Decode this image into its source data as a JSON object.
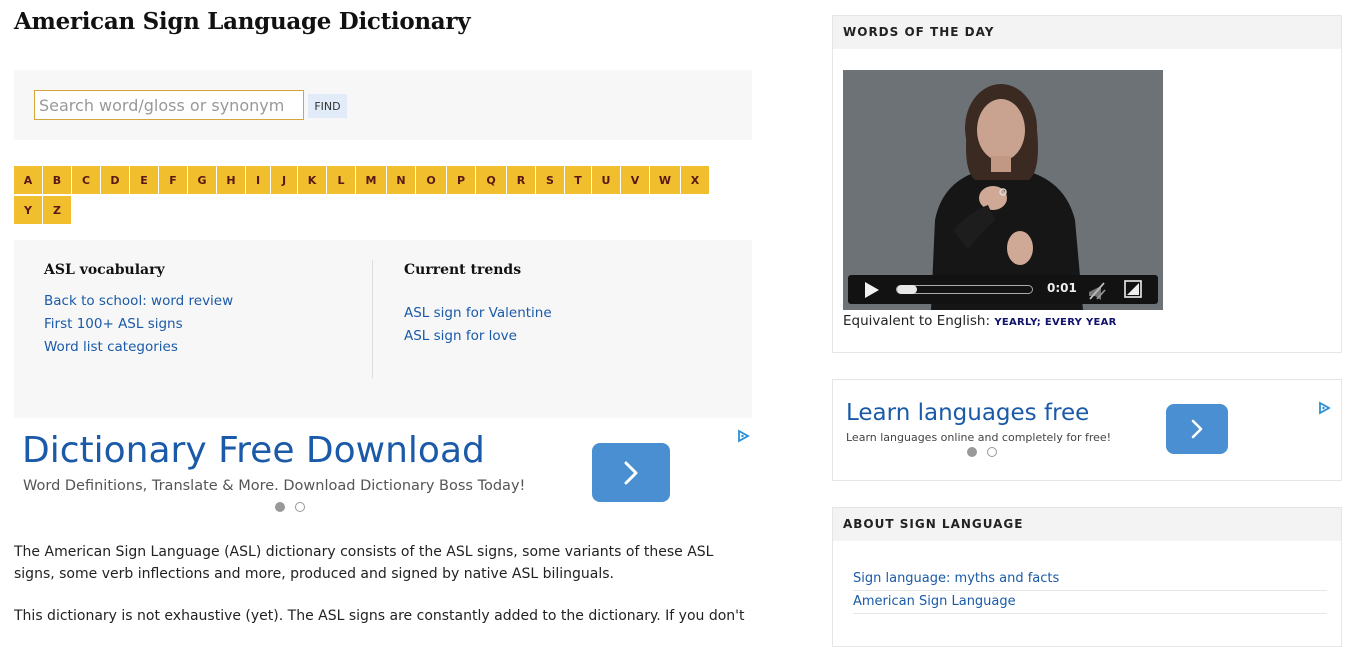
{
  "page": {
    "title": "American Sign Language Dictionary"
  },
  "search": {
    "placeholder": "Search word/gloss or synonym",
    "value": "",
    "button_label": "FIND"
  },
  "alphabet": [
    "A",
    "B",
    "C",
    "D",
    "E",
    "F",
    "G",
    "H",
    "I",
    "J",
    "K",
    "L",
    "M",
    "N",
    "O",
    "P",
    "Q",
    "R",
    "S",
    "T",
    "U",
    "V",
    "W",
    "X",
    "Y",
    "Z"
  ],
  "vocabulary": {
    "heading": "ASL vocabulary",
    "links": [
      "Back to school: word review",
      "First 100+ ASL signs",
      "Word list categories"
    ]
  },
  "trends": {
    "heading": "Current trends",
    "links": [
      "ASL sign for Valentine",
      "ASL sign for love"
    ]
  },
  "main_ad": {
    "title": "Dictionary Free Download",
    "subtitle": "Word Definitions, Translate & More. Download Dictionary Boss Today!",
    "button_icon": "chevron-right-icon",
    "active_dot": 0,
    "dot_count": 2
  },
  "intro": {
    "paragraph1": "The American Sign Language (ASL) dictionary consists of the ASL signs, some variants of these ASL signs, some verb inflections and more, produced and signed by native ASL bilinguals.",
    "paragraph2": "This dictionary is not exhaustive (yet). The ASL signs are constantly added to the dictionary. If you don't"
  },
  "words_of_the_day": {
    "header": "WORDS OF THE DAY",
    "video": {
      "time": "0:01",
      "progress": 0.05,
      "controls": [
        "play-icon",
        "mute-icon",
        "fullscreen-icon"
      ]
    },
    "equivalent_label": "Equivalent to English:",
    "equivalent_words": "YEARLY; EVERY YEAR"
  },
  "side_ad": {
    "title": "Learn languages free",
    "subtitle": "Learn languages online and completely for free!",
    "button_icon": "chevron-right-icon",
    "active_dot": 0,
    "dot_count": 2
  },
  "about": {
    "header": "ABOUT SIGN LANGUAGE",
    "links": [
      "Sign language: myths and facts",
      "American Sign Language"
    ]
  },
  "colors": {
    "letter_bg": "#f1bf2e",
    "link": "#1a5aa8",
    "ad_button": "#4a8fd1",
    "panel_bg": "#f7f7f7"
  }
}
